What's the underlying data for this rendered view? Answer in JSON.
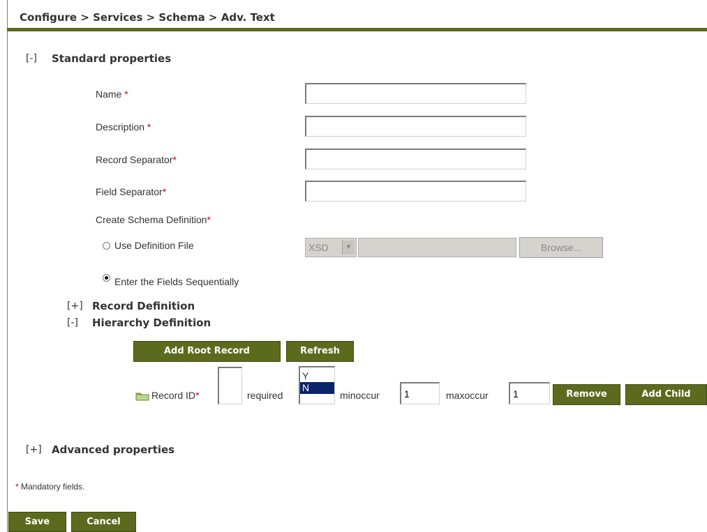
{
  "header": {
    "breadcrumb": "Configure > Services > Schema > Adv. Text"
  },
  "standard": {
    "toggle": "[-]",
    "title": "Standard properties",
    "fields": {
      "name_label": "Name",
      "name_req": "*",
      "name_value": "",
      "description_label": "Description",
      "description_req": "*",
      "description_value": "",
      "record_sep_label": "Record Separator",
      "record_sep_req": "*",
      "record_sep_value": "",
      "field_sep_label": "Field Separator",
      "field_sep_req": "*",
      "field_sep_value": ""
    },
    "schema_def_label": "Create Schema Definition",
    "schema_def_req": "*",
    "use_file_label": "Use Definition File",
    "file_type": "XSD",
    "browse_label": "Browse...",
    "sequential_label": "Enter the Fields Sequentially"
  },
  "record_def": {
    "toggle": "[+]",
    "title": "Record Definition"
  },
  "hierarchy": {
    "toggle": "[-]",
    "title": "Hierarchy Definition",
    "add_root_label": "Add Root Record",
    "refresh_label": "Refresh",
    "row": {
      "record_id_label": "Record ID",
      "record_id_req": "*",
      "record_id_value": "",
      "required_label": "required",
      "required_options": [
        "Y",
        "N"
      ],
      "required_selected": "N",
      "minoccur_label": "minoccur",
      "minoccur_value": "1",
      "maxoccur_label": "maxoccur",
      "maxoccur_value": "1",
      "remove_label": "Remove",
      "add_child_label": "Add Child"
    }
  },
  "advanced": {
    "toggle": "[+]",
    "title": "Advanced properties"
  },
  "footer": {
    "mandatory_mark": "*",
    "mandatory_note": " Mandatory fields.",
    "save_label": "Save",
    "cancel_label": "Cancel"
  },
  "colors": {
    "accent": "#5c6a1e",
    "required": "#cc0000",
    "selection": "#0a246a"
  }
}
